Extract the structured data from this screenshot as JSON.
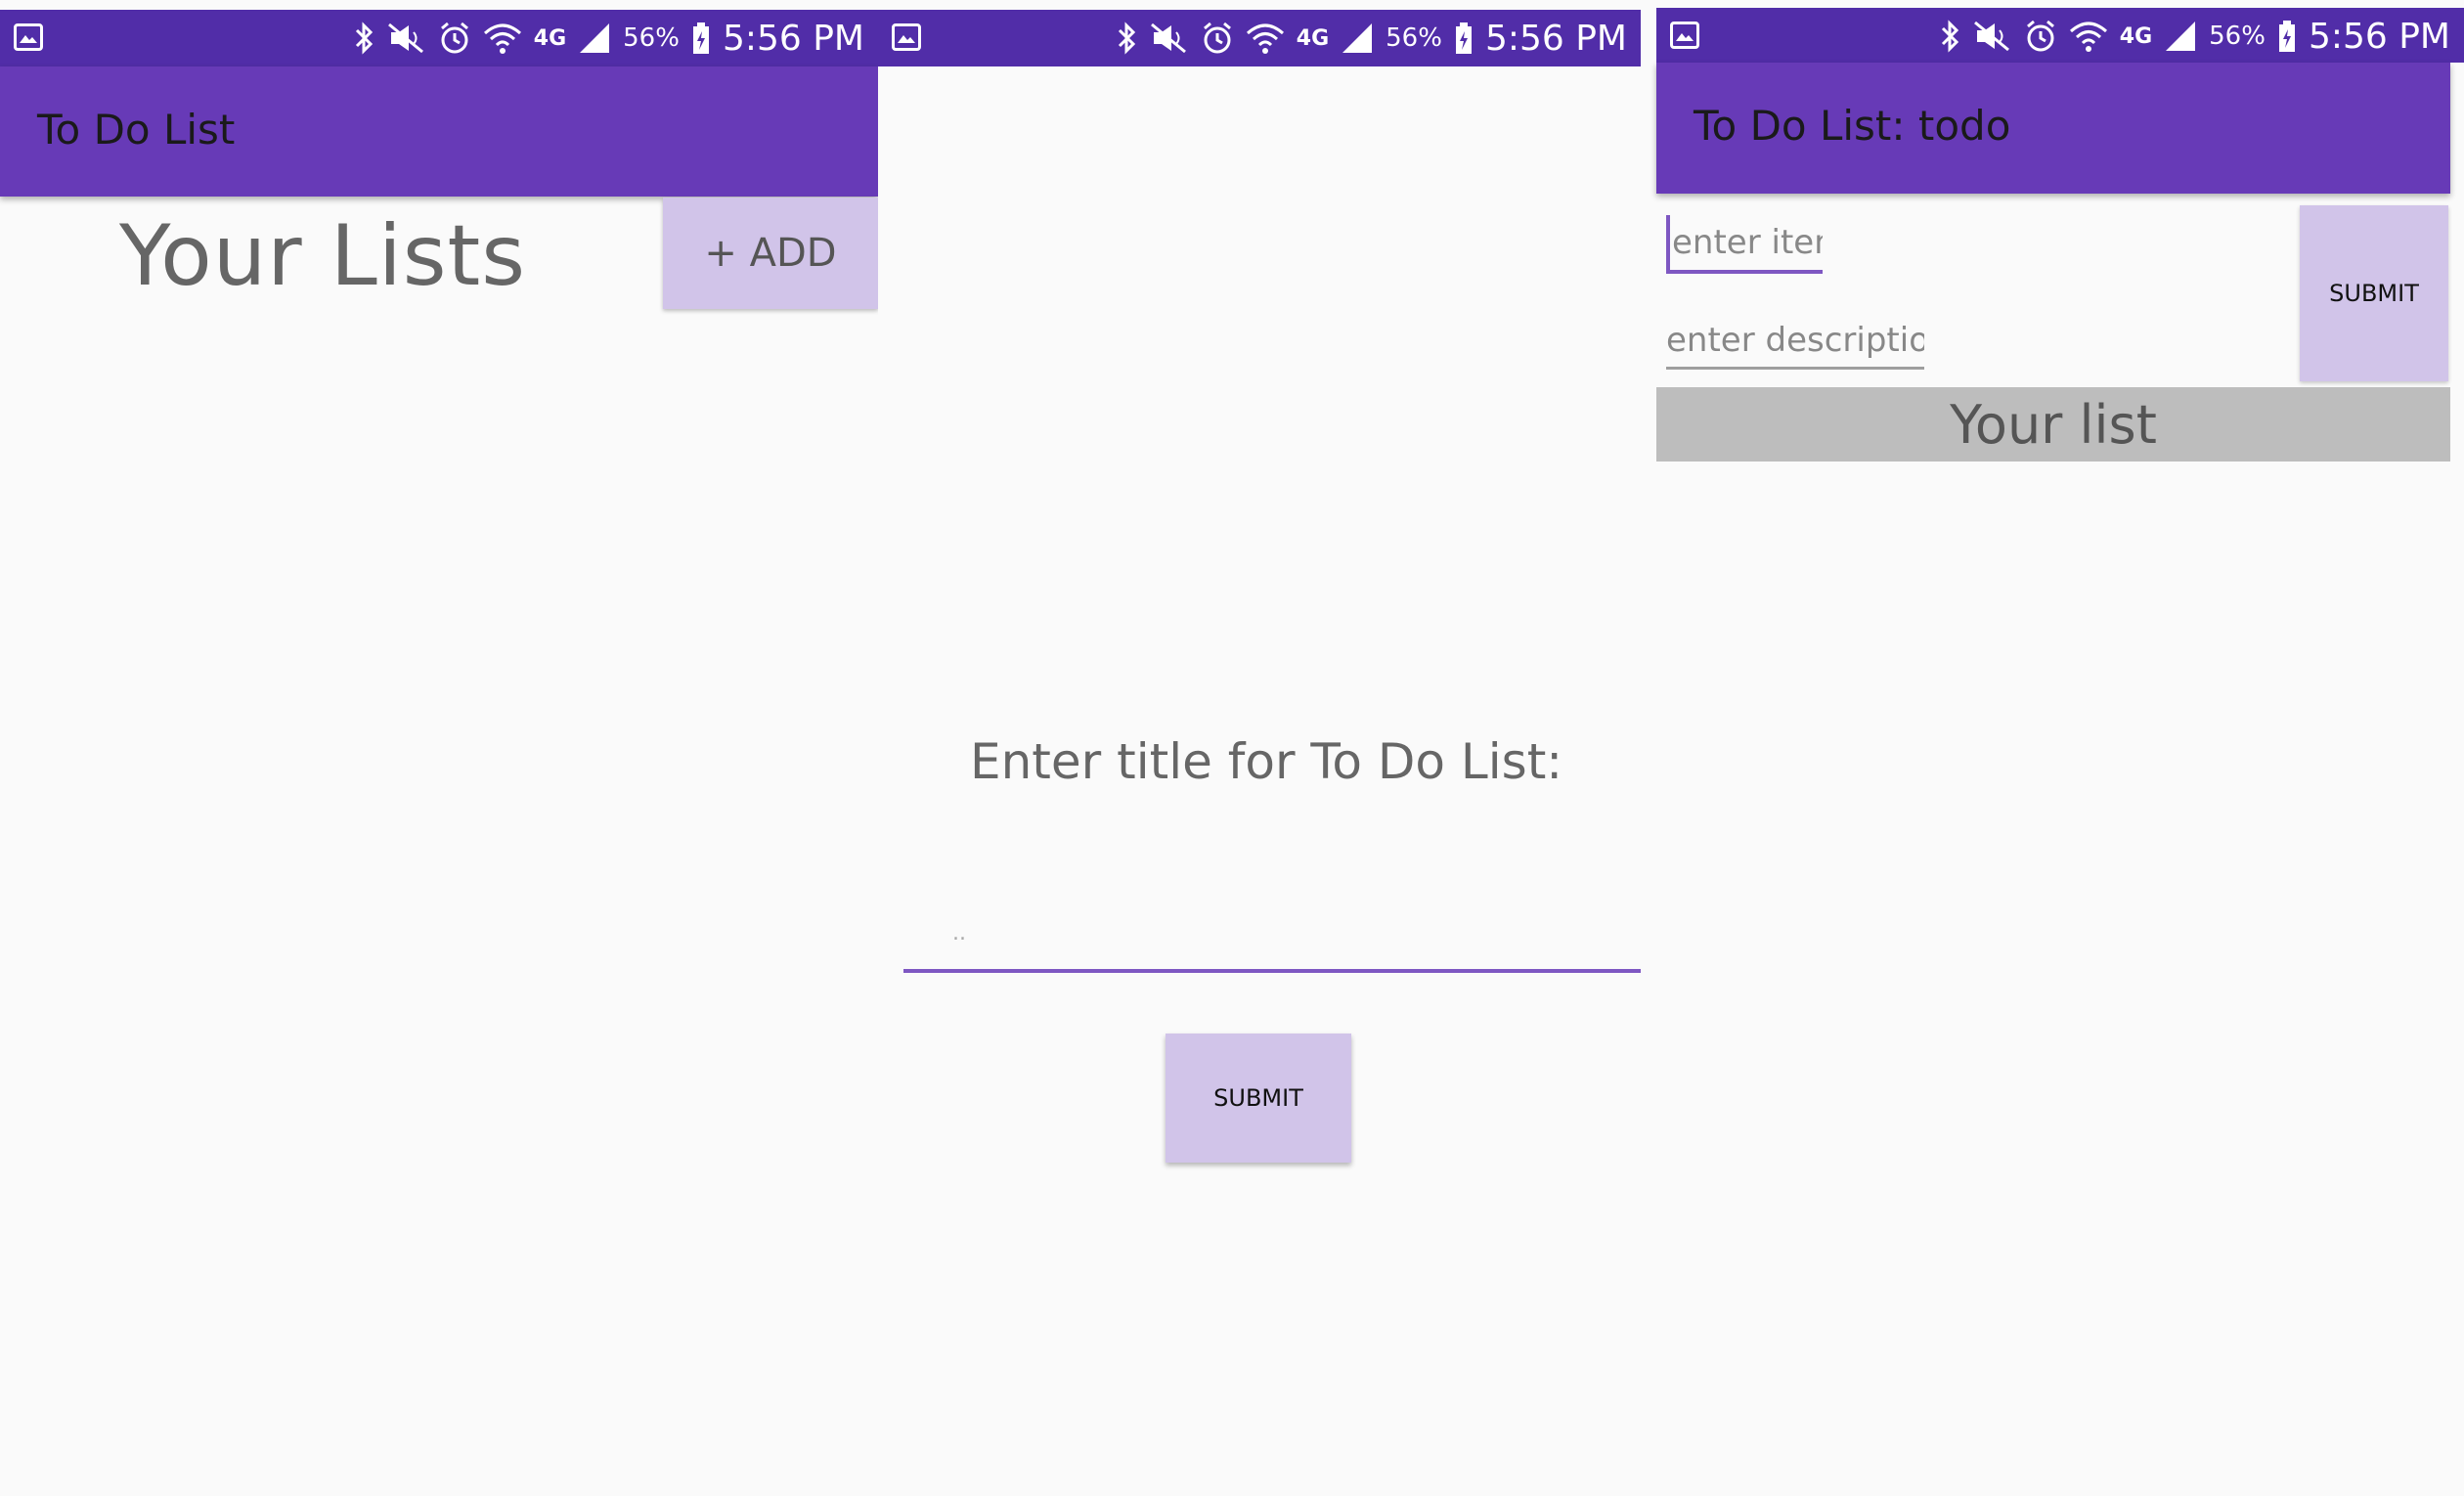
{
  "colors": {
    "status_bar": "#512da8",
    "app_bar": "#673ab7",
    "button": "#d1c4e9",
    "input_underline": "#7e57c2",
    "list_header": "#bdbdbd",
    "background": "#fafafa"
  },
  "status_bar": {
    "battery_percent": "56%",
    "time": "5:56 PM",
    "network": "4G",
    "icons": [
      "image-icon",
      "bluetooth-icon",
      "mute-icon",
      "alarm-icon",
      "wifi-icon",
      "4g-icon",
      "signal-icon",
      "battery-icon"
    ]
  },
  "screen_lists": {
    "app_title": "To Do List",
    "heading": "Your Lists",
    "add_button_label": "+ ADD"
  },
  "screen_new_list": {
    "prompt": "Enter title for To Do List:",
    "title_input_placeholder": "..",
    "submit_label": "SUBMIT"
  },
  "screen_list_detail": {
    "app_title": "To Do List: todo",
    "item_placeholder": "enter item",
    "description_placeholder": "enter description",
    "submit_label": "SUBMIT",
    "list_header": "Your list"
  }
}
